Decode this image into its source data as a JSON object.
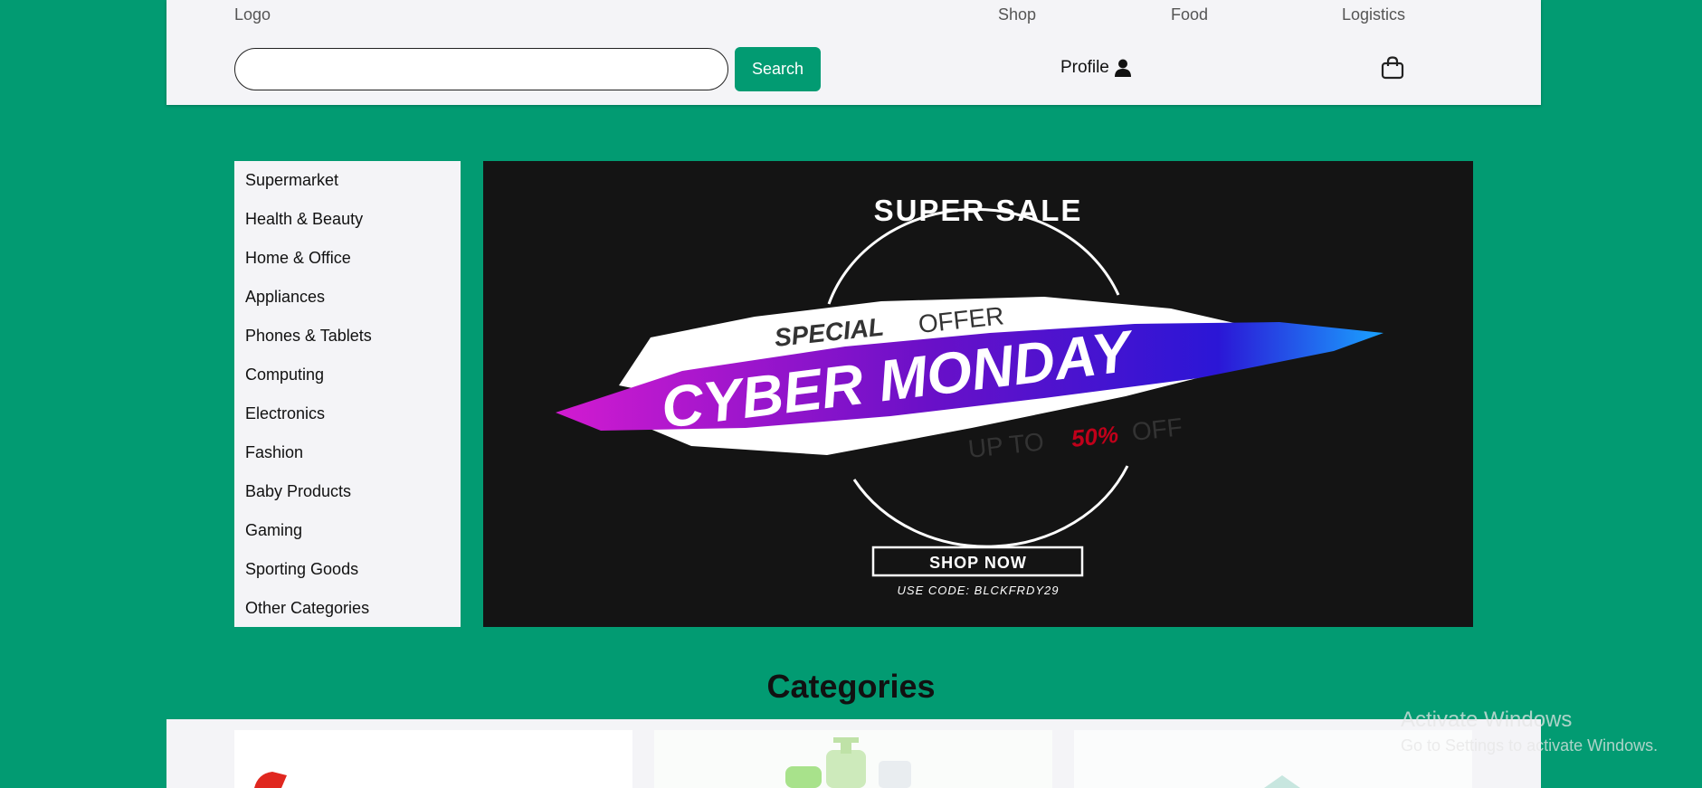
{
  "header": {
    "logo": "Logo",
    "nav": [
      "Shop",
      "Food",
      "Logistics"
    ],
    "search_placeholder": "",
    "search_button": "Search",
    "profile_label": "Profile"
  },
  "sidebar": {
    "items": [
      "Supermarket",
      "Health & Beauty",
      "Home & Office",
      "Appliances",
      "Phones & Tablets",
      "Computing",
      "Electronics",
      "Fashion",
      "Baby Products",
      "Gaming",
      "Sporting Goods",
      "Other Categories"
    ]
  },
  "banner": {
    "headline": "SUPER SALE",
    "special": "SPECIAL",
    "offer": "OFFER",
    "main": "CYBER MONDAY",
    "up_to": "UP TO",
    "percent": "50%",
    "off": "OFF",
    "cta": "SHOP NOW",
    "code": "USE CODE: BLCKFRDY29"
  },
  "categories": {
    "title": "Categories"
  },
  "watermark": {
    "title": "Activate Windows",
    "subtitle": "Go to Settings to activate Windows."
  },
  "colors": {
    "brand": "#029b72",
    "panel": "#f4f4f7",
    "banner_bg": "#141414",
    "accent_red": "#c0001a"
  }
}
